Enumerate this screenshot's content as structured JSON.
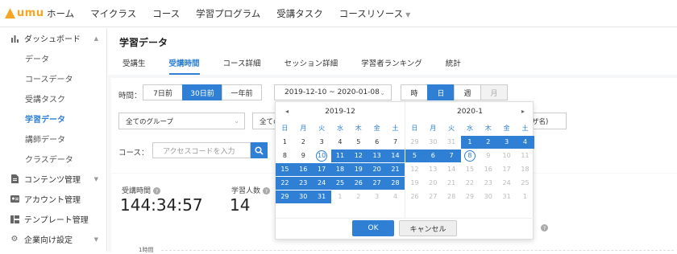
{
  "nav": {
    "logo": "umu",
    "items": [
      "ホーム",
      "マイクラス",
      "コース",
      "学習プログラム",
      "受講タスク",
      "コースリソース"
    ]
  },
  "sidebar": {
    "groups": [
      {
        "label": "ダッシュボード",
        "icon": "bar-chart-icon"
      },
      {
        "label": "コンテンツ管理",
        "icon": "document-icon"
      },
      {
        "label": "アカウント管理",
        "icon": "id-card-icon"
      },
      {
        "label": "テンプレート管理",
        "icon": "template-icon"
      },
      {
        "label": "企業向け設定",
        "icon": "gear-icon"
      }
    ],
    "items": [
      "データ",
      "コースデータ",
      "受講タスク",
      "学習データ",
      "講師データ",
      "クラスデータ"
    ]
  },
  "page": {
    "title": "学習データ"
  },
  "tabs": [
    "受講生",
    "受講時間",
    "コース詳細",
    "セッション詳細",
    "学習者ランキング",
    "統計"
  ],
  "filters": {
    "period_label": "時間：",
    "period_options": [
      "7日前",
      "30日前",
      "一年前"
    ],
    "date_range": "2019-12-10 ~ 2020-01-08",
    "granularity": [
      "時",
      "日",
      "週",
      "月"
    ],
    "group_select": "全てのグループ",
    "second_select": "全ての",
    "name_suffix": "ザ名)",
    "course_label": "コース：",
    "course_placeholder": "アクセスコードを入力"
  },
  "stats": {
    "time_label": "受講時間",
    "time_value": "144:34:57",
    "learners_label": "学習人数",
    "learners_value": "14",
    "axis_tick": "1時間"
  },
  "calendar": {
    "dow": [
      "日",
      "月",
      "火",
      "水",
      "木",
      "金",
      "土"
    ],
    "left": {
      "title": "2019-12",
      "weeks": [
        [
          "1",
          "2",
          "3",
          "4",
          "5",
          "6",
          "7"
        ],
        [
          "8",
          "9",
          "10",
          "11",
          "12",
          "13",
          "14"
        ],
        [
          "15",
          "16",
          "17",
          "18",
          "19",
          "20",
          "21"
        ],
        [
          "22",
          "23",
          "24",
          "25",
          "26",
          "27",
          "28"
        ],
        [
          "29",
          "30",
          "31",
          "1",
          "2",
          "3",
          "4"
        ]
      ]
    },
    "right": {
      "title": "2020-1",
      "weeks": [
        [
          "29",
          "30",
          "31",
          "1",
          "2",
          "3",
          "4"
        ],
        [
          "5",
          "6",
          "7",
          "8",
          "9",
          "10",
          "11"
        ],
        [
          "12",
          "13",
          "14",
          "15",
          "16",
          "17",
          "18"
        ],
        [
          "19",
          "20",
          "21",
          "22",
          "23",
          "24",
          "25"
        ],
        [
          "26",
          "27",
          "28",
          "29",
          "30",
          "31",
          "1"
        ]
      ]
    },
    "ok": "OK",
    "cancel": "キャンセル"
  }
}
